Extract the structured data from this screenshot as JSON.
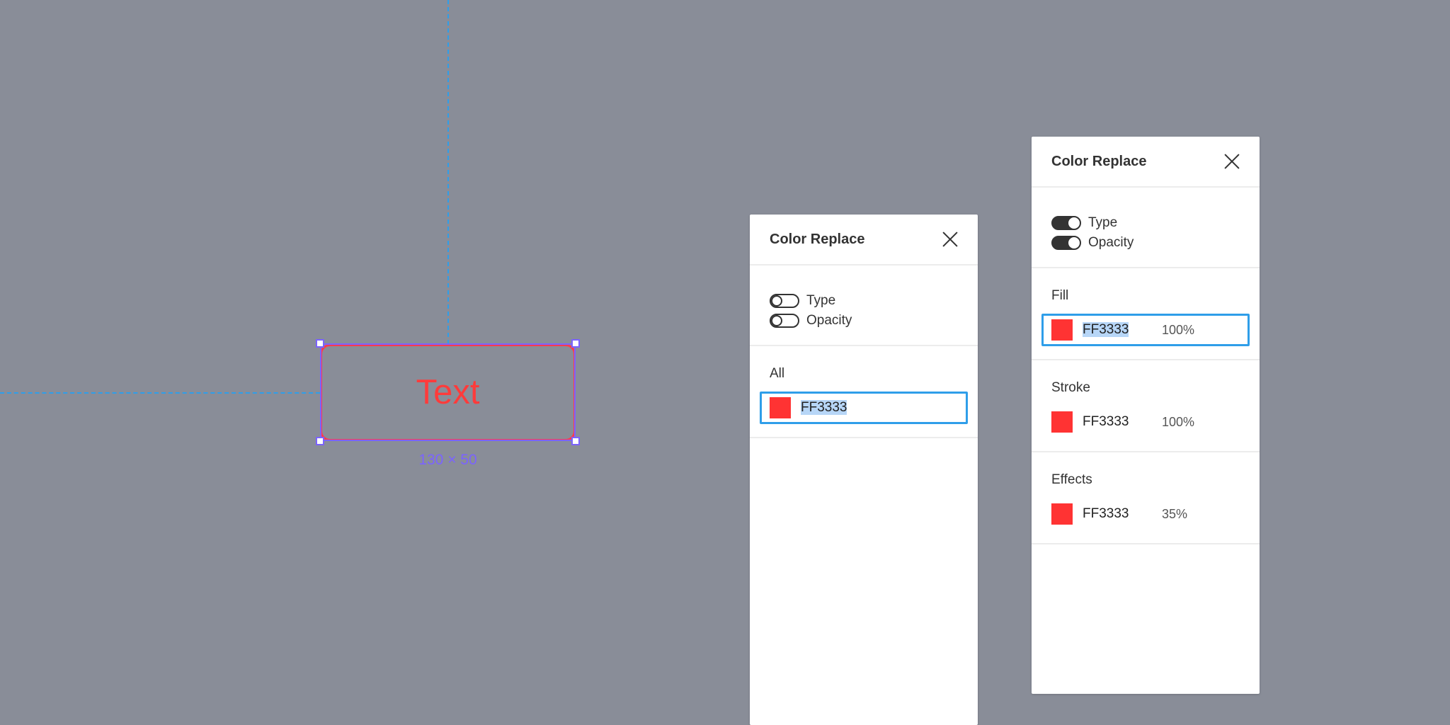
{
  "canvas": {
    "shape_text": "Text",
    "size_label": "130 × 50",
    "shape_color": "#FF3333"
  },
  "panel_left": {
    "title": "Color Replace",
    "toggles": [
      {
        "label": "Type",
        "on": false
      },
      {
        "label": "Opacity",
        "on": false
      }
    ],
    "all_section": {
      "title": "All",
      "color_hex": "FF3333",
      "color": "#FF3333"
    }
  },
  "panel_right": {
    "title": "Color Replace",
    "toggles": [
      {
        "label": "Type",
        "on": true
      },
      {
        "label": "Opacity",
        "on": true
      }
    ],
    "fill": {
      "title": "Fill",
      "color_hex": "FF3333",
      "opacity": "100%",
      "color": "#FF3333"
    },
    "stroke": {
      "title": "Stroke",
      "color_hex": "FF3333",
      "opacity": "100%",
      "color": "#FF3333"
    },
    "effects": {
      "title": "Effects",
      "color_hex": "FF3333",
      "opacity": "35%",
      "color": "#FF3333"
    }
  },
  "colors": {
    "accent_blue": "#2F9EE9",
    "selection_purple": "#7B63FF",
    "canvas_bg": "#898D98"
  }
}
